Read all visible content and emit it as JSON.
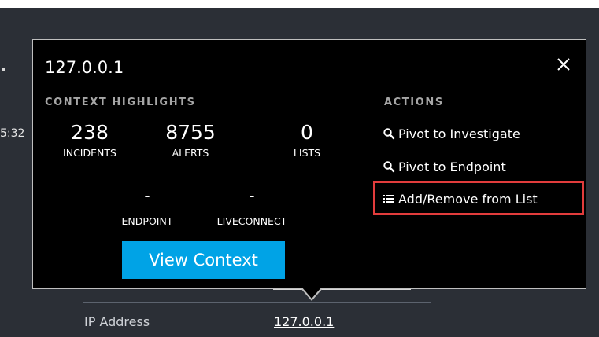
{
  "background": {
    "time_fragment": "5:32",
    "field_label": "IP Address",
    "field_value": "127.0.0.1"
  },
  "popup": {
    "title": "127.0.0.1",
    "context_heading": "CONTEXT HIGHLIGHTS",
    "actions_heading": "ACTIONS",
    "stats": [
      {
        "value": "238",
        "label": "INCIDENTS"
      },
      {
        "value": "8755",
        "label": "ALERTS"
      },
      {
        "value": "0",
        "label": "LISTS"
      }
    ],
    "stats_secondary": [
      {
        "value": "-",
        "label": "ENDPOINT"
      },
      {
        "value": "-",
        "label": "LIVECONNECT"
      }
    ],
    "view_context_label": "View Context",
    "actions": [
      {
        "label": "Pivot to Investigate",
        "icon": "search-icon"
      },
      {
        "label": "Pivot to Endpoint",
        "icon": "search-icon"
      },
      {
        "label": "Add/Remove from List",
        "icon": "list-icon"
      }
    ]
  },
  "colors": {
    "background": "#2b2f36",
    "popup": "#000000",
    "accent_button": "#00a3e6",
    "highlight": "#e23c3c"
  }
}
